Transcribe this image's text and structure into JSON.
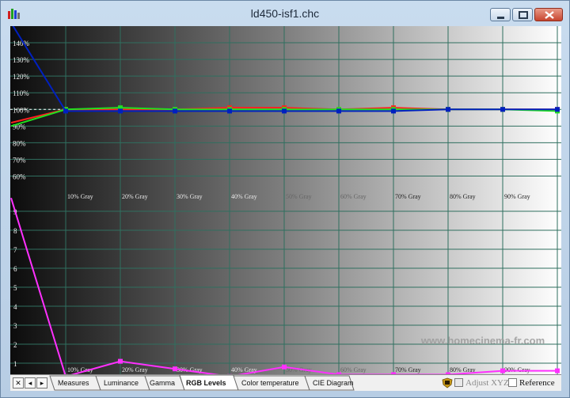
{
  "window": {
    "title": "ld450-isf1.chc"
  },
  "colors": {
    "red": "#ff2020",
    "green": "#20e020",
    "blue": "#0020c0",
    "magenta": "#ff30ff",
    "grid": "#2f6f5f"
  },
  "top_chart": {
    "y_ticks": [
      "140%",
      "130%",
      "120%",
      "110%",
      "100%",
      "90%",
      "80%",
      "70%",
      "60%"
    ],
    "x_labels": [
      "10% Gray",
      "20% Gray",
      "30% Gray",
      "40% Gray",
      "50% Gray",
      "60% Gray",
      "70% Gray",
      "80% Gray",
      "90% Gray"
    ]
  },
  "bottom_chart": {
    "y_ticks": [
      "9",
      "8",
      "7",
      "6",
      "5",
      "4",
      "3",
      "2",
      "1"
    ],
    "x_labels": [
      "10% Gray",
      "20% Gray",
      "30% Gray",
      "40% Gray",
      "50% Gray",
      "60% Gray",
      "70% Gray",
      "80% Gray",
      "90% Gray"
    ],
    "watermark": "www.homecinema-fr.com"
  },
  "chart_data": [
    {
      "type": "line",
      "x": [
        0,
        10,
        20,
        30,
        40,
        50,
        60,
        70,
        80,
        90,
        100
      ],
      "ylim": [
        55,
        150
      ],
      "series": [
        {
          "color": "#ff2020",
          "values": [
            92,
            100,
            100,
            100,
            101,
            101,
            100,
            101,
            100,
            100,
            100
          ]
        },
        {
          "color": "#20e020",
          "values": [
            90,
            100,
            101,
            100,
            100,
            100,
            100,
            100,
            100,
            100,
            99
          ]
        },
        {
          "color": "#0020c0",
          "values": [
            152,
            99,
            99,
            99,
            99,
            99,
            99,
            99,
            100,
            100,
            100
          ]
        }
      ]
    },
    {
      "type": "line",
      "x": [
        0,
        10,
        20,
        30,
        40,
        50,
        60,
        70,
        80,
        90,
        100
      ],
      "ylim": [
        0,
        10
      ],
      "series": [
        {
          "color": "#ff30ff",
          "values": [
            9.7,
            0.3,
            1.1,
            0.7,
            0.3,
            0.8,
            0.4,
            0.4,
            0.4,
            0.6,
            0.6
          ]
        }
      ]
    }
  ],
  "toolbar": {
    "nav_close": "✕",
    "nav_prev": "◂",
    "nav_next": "▸",
    "tabs": [
      "Measures",
      "Luminance",
      "Gamma",
      "RGB Levels",
      "Color temperature",
      "CIE Diagram"
    ],
    "active_tab": "RGB Levels",
    "adjust_xyz_label": "Adjust XYZ",
    "reference_label": "Reference",
    "adjust_xyz_checked": false,
    "reference_checked": false
  }
}
